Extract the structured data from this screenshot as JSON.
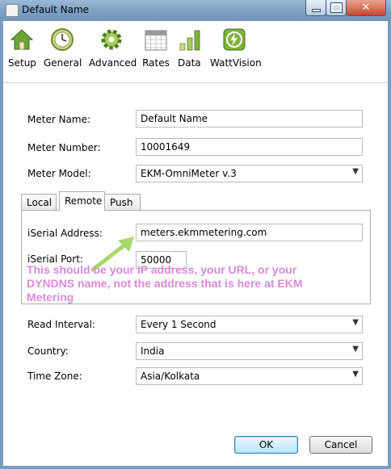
{
  "window": {
    "title": "Default Name"
  },
  "toolbar": {
    "items": [
      {
        "label": "Setup",
        "icon": "house-icon"
      },
      {
        "label": "General",
        "icon": "clock-icon"
      },
      {
        "label": "Advanced",
        "icon": "gear-icon"
      },
      {
        "label": "Rates",
        "icon": "calendar-icon"
      },
      {
        "label": "Data",
        "icon": "bar-chart-icon"
      },
      {
        "label": "WattVision",
        "icon": "lightning-icon"
      }
    ]
  },
  "form": {
    "meter_name_label": "Meter Name:",
    "meter_name_value": "Default Name",
    "meter_number_label": "Meter Number:",
    "meter_number_value": "10001649",
    "meter_model_label": "Meter Model:",
    "meter_model_value": "EKM-OmniMeter v.3",
    "read_interval_label": "Read Interval:",
    "read_interval_value": "Every 1 Second",
    "country_label": "Country:",
    "country_value": "India",
    "time_zone_label": "Time Zone:",
    "time_zone_value": "Asia/Kolkata"
  },
  "tabs": [
    {
      "label": "Local"
    },
    {
      "label": "Remote"
    },
    {
      "label": "Push"
    }
  ],
  "remote": {
    "iserial_address_label": "iSerial Address:",
    "iserial_address_value": "meters.ekmmetering.com",
    "iserial_port_label": "iSerial Port:",
    "iserial_port_value": "50000"
  },
  "annotation": {
    "text": "This should be your IP address, your URL, or your DYNDNS name, not the address that is here at EKM Metering",
    "color": "#d98ad9",
    "arrow_color": "#a8d86a"
  },
  "buttons": {
    "ok": "OK",
    "cancel": "Cancel"
  },
  "colors": {
    "titlebar": "#7da1c4",
    "ok_button": "#bee6fd"
  }
}
